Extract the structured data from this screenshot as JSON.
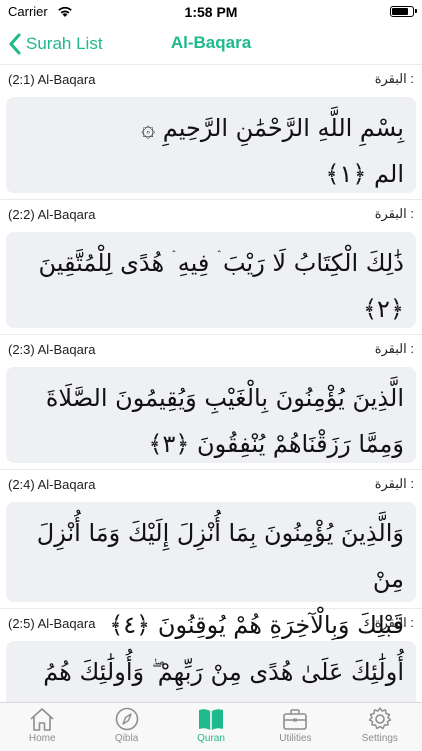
{
  "status_bar": {
    "carrier": "Carrier",
    "time": "1:58 PM",
    "battery_level": 0.9
  },
  "nav": {
    "back_label": "Surah List",
    "title": "Al-Baqara"
  },
  "verses": [
    {
      "ref": "(2:1) Al-Baqara",
      "surah_ar": "البقرة :",
      "lines": [
        "بِسْمِ اللَّهِ الرَّحْمَٰنِ الرَّحِيمِ ۞",
        "الم ﴿١﴾"
      ]
    },
    {
      "ref": "(2:2) Al-Baqara",
      "surah_ar": "البقرة :",
      "lines": [
        "ذَٰلِكَ الْكِتَابُ لَا رَيْبَ ۛ فِيهِ ۛ هُدًى لِلْمُتَّقِينَ",
        "﴿٢﴾"
      ]
    },
    {
      "ref": "(2:3) Al-Baqara",
      "surah_ar": "البقرة :",
      "lines": [
        "الَّذِينَ يُؤْمِنُونَ بِالْغَيْبِ وَيُقِيمُونَ الصَّلَاةَ",
        "وَمِمَّا رَزَقْنَاهُمْ يُنْفِقُونَ ﴿٣﴾"
      ]
    },
    {
      "ref": "(2:4) Al-Baqara",
      "surah_ar": "البقرة :",
      "lines": [
        "وَالَّذِينَ يُؤْمِنُونَ بِمَا أُنْزِلَ إِلَيْكَ وَمَا أُنْزِلَ مِنْ",
        "قَبْلِكَ وَبِالْآخِرَةِ هُمْ يُوقِنُونَ ﴿٤﴾"
      ]
    },
    {
      "ref": "(2:5) Al-Baqara",
      "surah_ar": "البقرة :",
      "lines": [
        "أُولَٰئِكَ عَلَىٰ هُدًى مِنْ رَبِّهِمْ ۖ وَأُولَٰئِكَ هُمُ"
      ]
    }
  ],
  "tabs": [
    {
      "label": "Home",
      "icon": "home-icon"
    },
    {
      "label": "Qibla",
      "icon": "compass-icon"
    },
    {
      "label": "Quran",
      "icon": "book-icon",
      "active": true
    },
    {
      "label": "Utilities",
      "icon": "briefcase-icon"
    },
    {
      "label": "Settings",
      "icon": "gear-icon"
    }
  ],
  "colors": {
    "accent": "#1fb98b",
    "card_bg": "#eef0f4",
    "inactive": "#8e8e93"
  }
}
